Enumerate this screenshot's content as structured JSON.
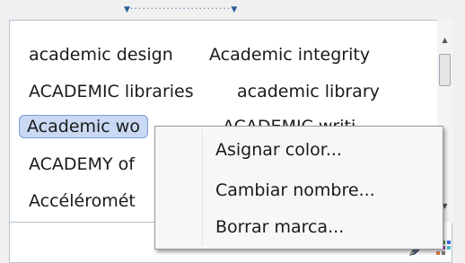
{
  "splitter": {
    "left_arrow": "▼",
    "dots": "·························",
    "right_arrow": "▼"
  },
  "tags": [
    {
      "label": "academic design"
    },
    {
      "label": "Academic integrity"
    },
    {
      "label": "ACADEMIC libraries"
    },
    {
      "label": "academic library"
    },
    {
      "label": "Academic wo"
    },
    {
      "label": "ACADEMIC writi"
    },
    {
      "label": "ACADEMY of"
    },
    {
      "label": "Accéléromét"
    }
  ],
  "context_menu": {
    "items": [
      {
        "label": "Asignar color..."
      },
      {
        "label": "Cambiar nombre..."
      },
      {
        "label": "Borrar marca..."
      }
    ]
  },
  "scrollbar": {
    "up_arrow": "▲",
    "down_arrow": "▼"
  },
  "icons": {
    "pencil": "pencil-icon",
    "palette": "palette-icon"
  }
}
